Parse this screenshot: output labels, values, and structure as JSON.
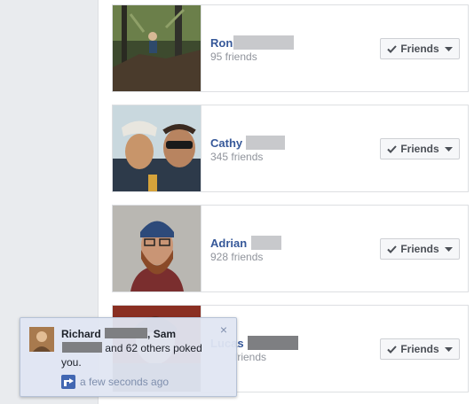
{
  "friends": [
    {
      "first_name": "Ron",
      "friend_count": "95 friends",
      "button_label": "Friends"
    },
    {
      "first_name": "Cathy",
      "friend_count": "345 friends",
      "button_label": "Friends"
    },
    {
      "first_name": "Adrian",
      "friend_count": "928 friends",
      "button_label": "Friends"
    },
    {
      "first_name": "Lucas",
      "friend_count": "friends",
      "button_label": "Friends"
    }
  ],
  "notification": {
    "name1": "Richard",
    "name2": "Sam",
    "text": "and 62 others poked you.",
    "time": "a few seconds ago",
    "close_glyph": "×"
  },
  "colors": {
    "link": "#365899",
    "muted": "#90949c",
    "toast_bg": "#e0e6f2"
  }
}
